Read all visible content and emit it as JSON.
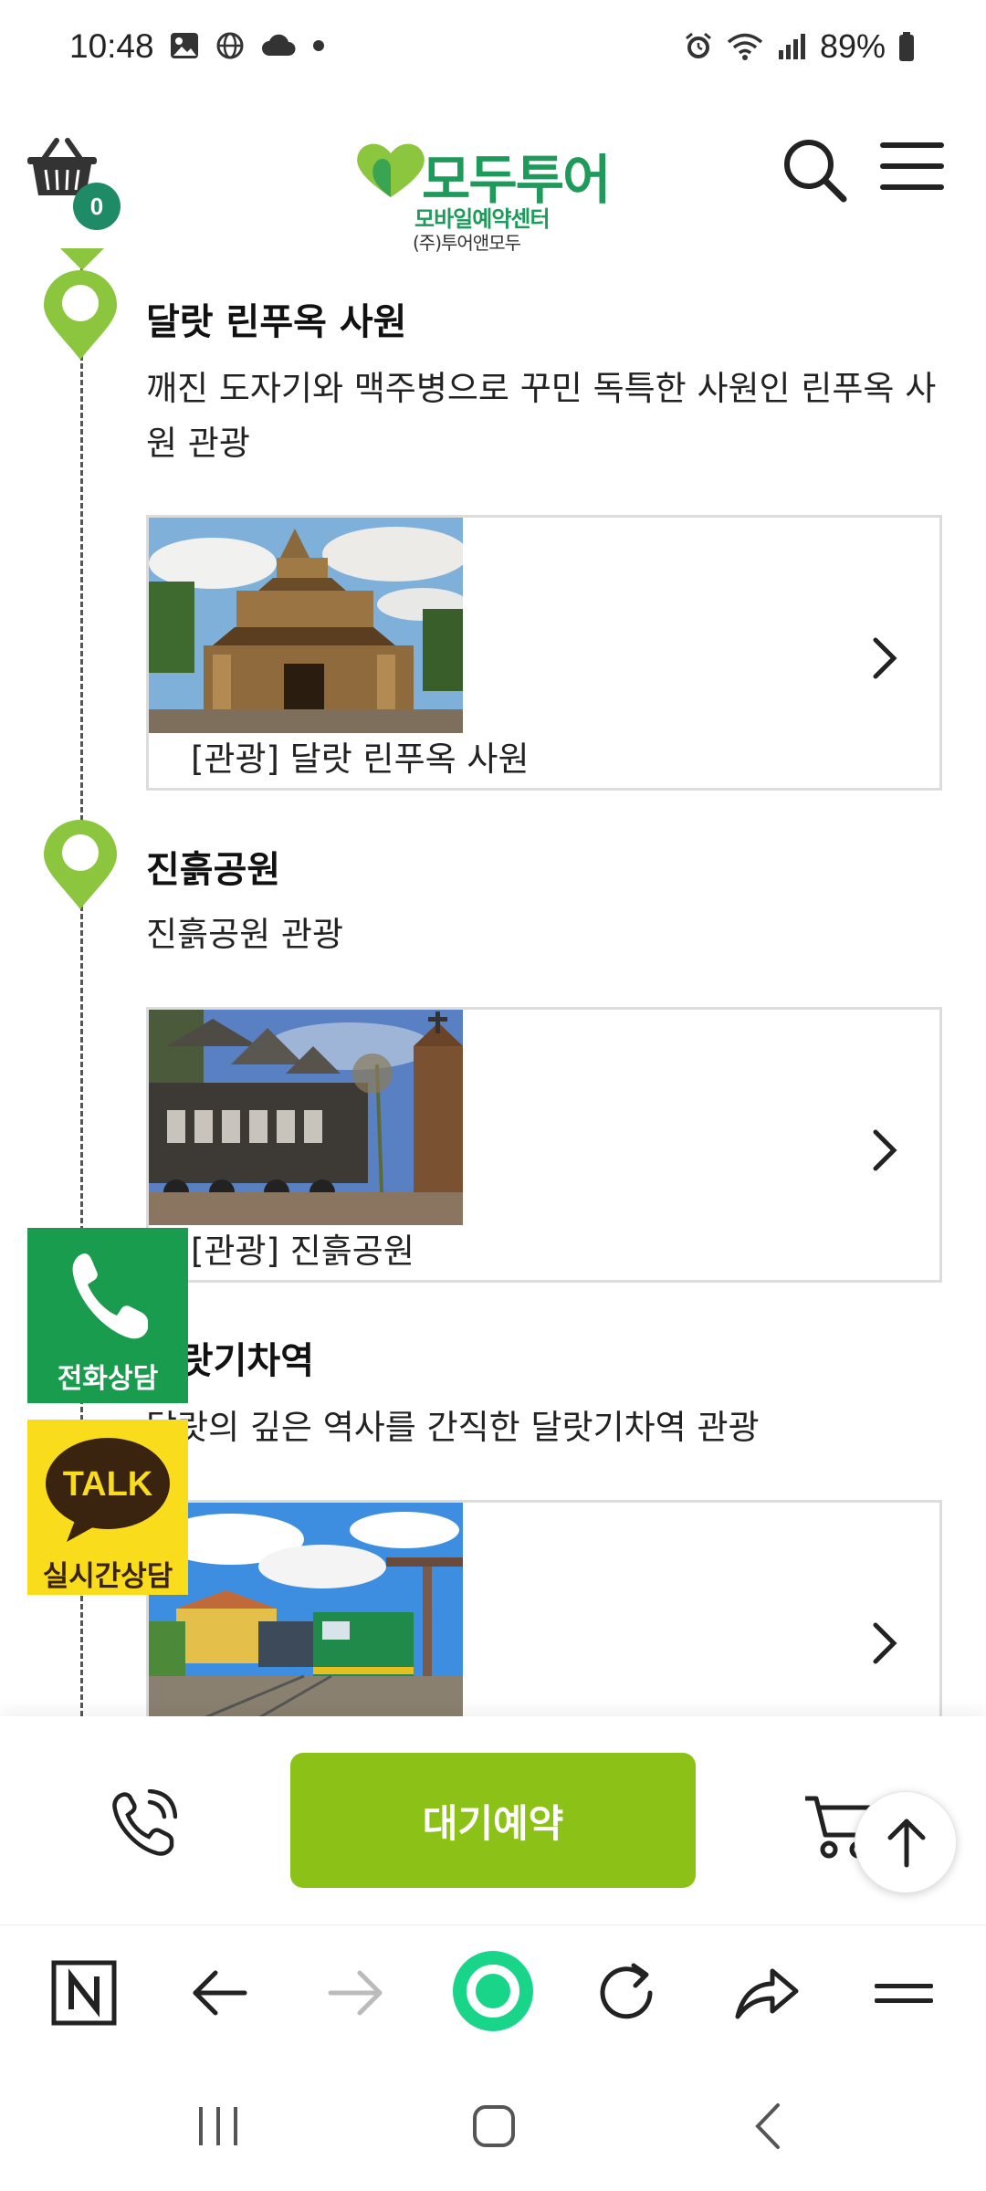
{
  "status_bar": {
    "time": "10:48",
    "battery": "89%"
  },
  "header": {
    "cart_count": "0",
    "logo_main": "모두투어",
    "logo_sub1": "모바일예약센터",
    "logo_sub2": "(주)투어앤모두",
    "icons": [
      "cart-icon",
      "search-icon",
      "hamburger-menu-icon"
    ]
  },
  "itinerary": [
    {
      "title": "달랏 린푸옥 사원",
      "description": "깨진 도자기와 맥주병으로 꾸민 독특한 사원인 린푸옥 사원 관광",
      "card_label": "[관광] 달랏 린푸옥 사원"
    },
    {
      "title": "진흙공원",
      "description": "진흙공원 관광",
      "card_label": "[관광] 진흙공원"
    },
    {
      "title": "달랏기차역",
      "description": "달랏의 깊은 역사를 간직한 달랏기차역 관광",
      "card_label": ""
    }
  ],
  "floating": {
    "call_label": "전화상담",
    "talk_badge": "TALK",
    "talk_label": "실시간상담"
  },
  "action_bar": {
    "reserve_label": "대기예약"
  },
  "browser_toolbar": {
    "icons": [
      "naver-n-icon",
      "back-arrow-icon",
      "forward-arrow-icon",
      "home-circle-icon",
      "refresh-icon",
      "share-icon",
      "menu-icon"
    ]
  },
  "colors": {
    "brand_green": "#1e9a5a",
    "accent_lime": "#8cc218",
    "call_green": "#1a9c4e",
    "kakao_yellow": "#f9dd1d"
  }
}
